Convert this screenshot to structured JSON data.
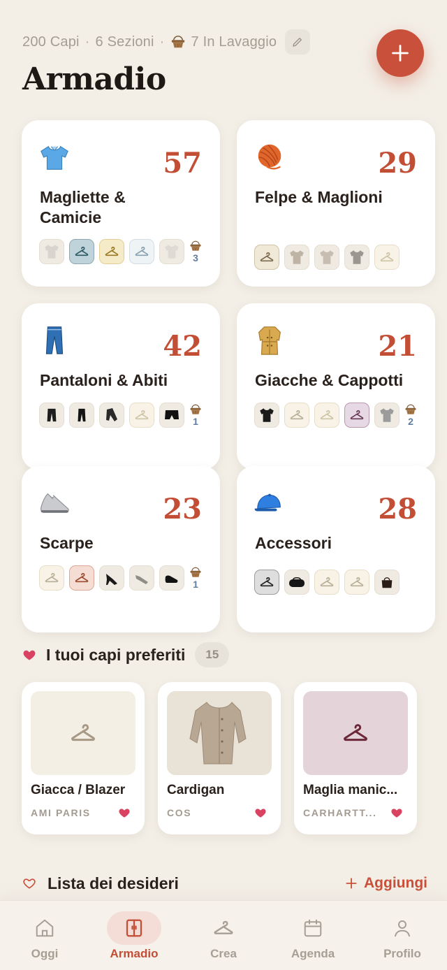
{
  "header": {
    "stats_capi": "200 Capi",
    "stats_sezioni": "6 Sezioni",
    "stats_lavaggio": "7 In Lavaggio",
    "separator": "·",
    "title": "Armadio"
  },
  "categories": [
    {
      "name": "Magliette & Camicie",
      "count": "57",
      "icon": "polo-shirt-icon",
      "laundry": "3"
    },
    {
      "name": "Felpe & Maglioni",
      "count": "29",
      "icon": "yarn-icon",
      "laundry": ""
    },
    {
      "name": "Pantaloni & Abiti",
      "count": "42",
      "icon": "jeans-icon",
      "laundry": "1"
    },
    {
      "name": "Giacche & Cappotti",
      "count": "21",
      "icon": "coat-icon",
      "laundry": "2"
    },
    {
      "name": "Scarpe",
      "count": "23",
      "icon": "sneaker-icon",
      "laundry": "1"
    },
    {
      "name": "Accessori",
      "count": "28",
      "icon": "cap-icon",
      "laundry": ""
    }
  ],
  "favorites": {
    "title": "I tuoi capi preferiti",
    "count": "15",
    "items": [
      {
        "name": "Giacca / Blazer",
        "brand": "AMI PARIS"
      },
      {
        "name": "Cardigan",
        "brand": "COS"
      },
      {
        "name": "Maglia manic...",
        "brand": "CARHARTT..."
      }
    ]
  },
  "wishlist": {
    "title": "Lista dei desideri",
    "add_label": "Aggiungi"
  },
  "tabs": [
    {
      "label": "Oggi",
      "icon": "home-icon"
    },
    {
      "label": "Armadio",
      "icon": "wardrobe-icon",
      "active": true
    },
    {
      "label": "Crea",
      "icon": "hanger-icon"
    },
    {
      "label": "Agenda",
      "icon": "calendar-icon"
    },
    {
      "label": "Profilo",
      "icon": "person-icon"
    }
  ],
  "colors": {
    "accent": "#C9503A",
    "count": "#C24E35",
    "background": "#F3EFE7",
    "heart": "#D94361",
    "laundry_count": "#5E7D9F"
  }
}
